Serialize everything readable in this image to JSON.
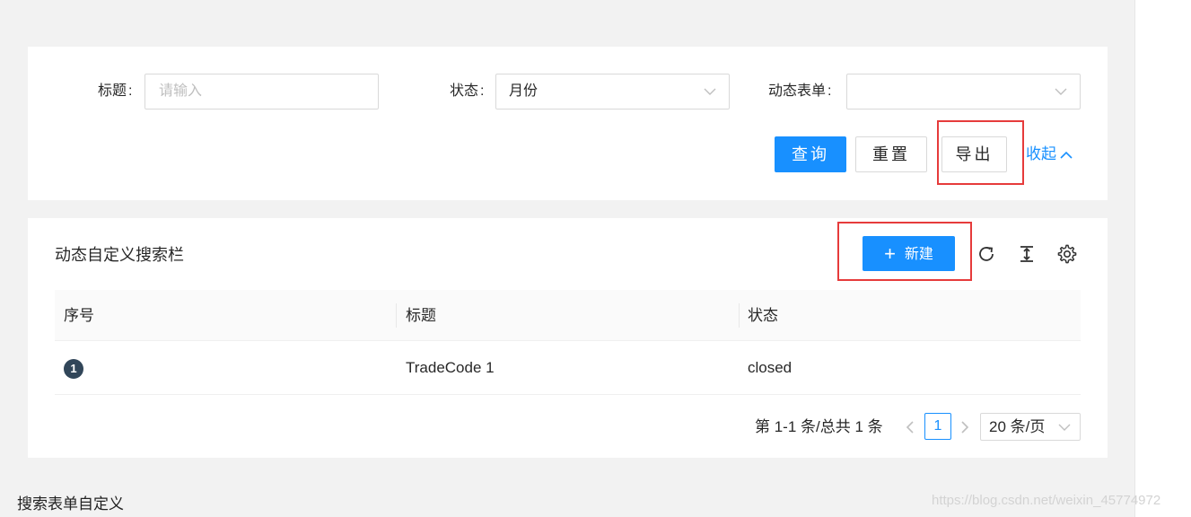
{
  "search": {
    "title_label": "标题",
    "title_placeholder": "请输入",
    "status_label": "状态",
    "status_value": "月份",
    "form_label": "动态表单",
    "form_value": "",
    "colon": ":",
    "query_label": "查询",
    "reset_label": "重置",
    "export_label": "导出",
    "collapse_label": "收起"
  },
  "table": {
    "title": "动态自定义搜索栏",
    "new_label": "新建",
    "columns": [
      "序号",
      "标题",
      "状态"
    ],
    "rows": [
      {
        "index": "1",
        "title": "TradeCode 1",
        "status": "closed"
      }
    ]
  },
  "pagination": {
    "total_text": "第 1-1 条/总共 1 条",
    "current_page": "1",
    "page_size": "20 条/页"
  },
  "footer_caption": "搜索表单自定义",
  "watermark": "https://blog.csdn.net/weixin_45774972",
  "colors": {
    "primary": "#1890ff",
    "highlight": "#e63b3b",
    "badge": "#314659"
  },
  "icons": [
    "chevron-down-icon",
    "chevron-up-icon",
    "plus-icon",
    "reload-icon",
    "column-height-icon",
    "settings-icon",
    "chevron-left-icon",
    "chevron-right-icon"
  ]
}
